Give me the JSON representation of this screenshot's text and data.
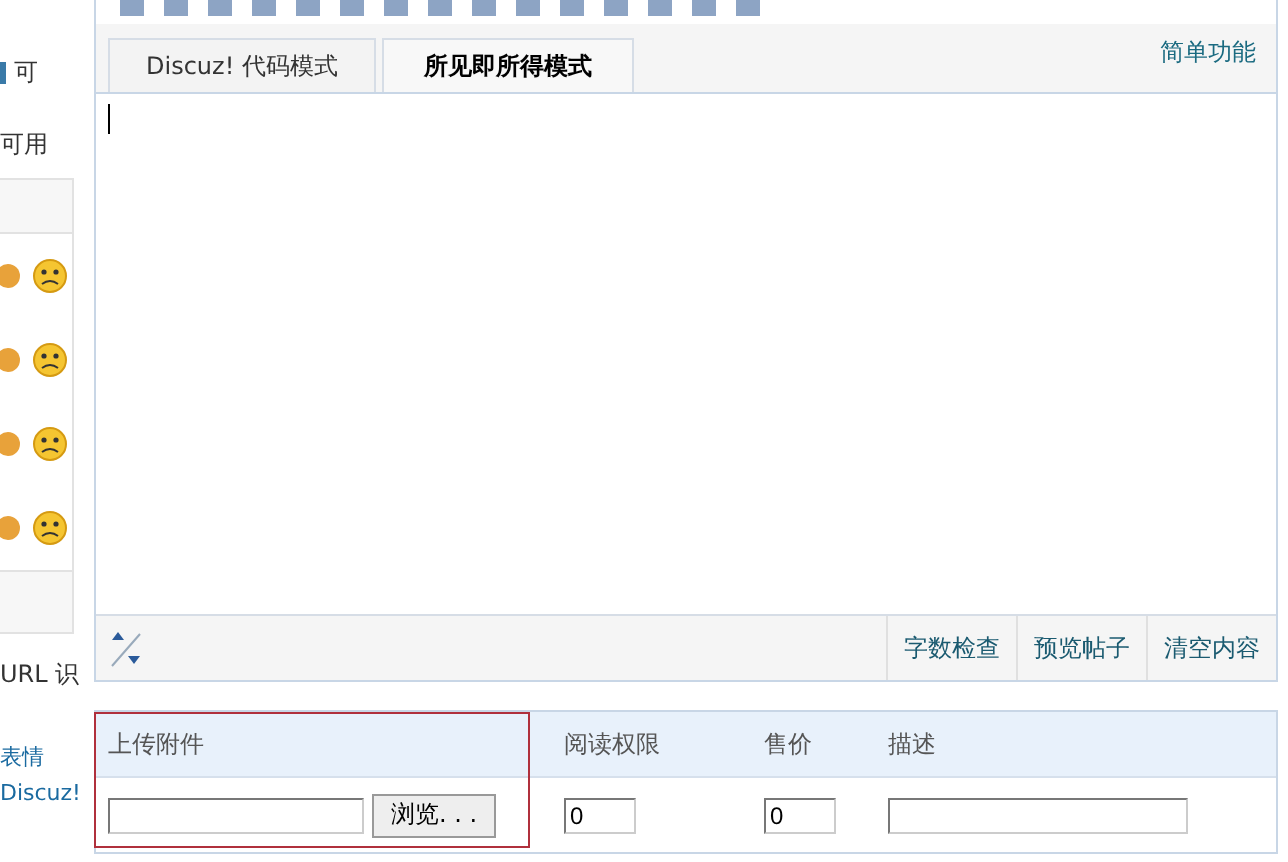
{
  "sidebar": {
    "texts": [
      "可",
      "可用"
    ],
    "footer_text": "URL 识",
    "links": [
      "表情",
      "Discuz!"
    ]
  },
  "editor": {
    "tabs": [
      {
        "label": "Discuz! 代码模式",
        "selected": false
      },
      {
        "label": "所见即所得模式",
        "selected": true
      }
    ],
    "mode_link": "简单功能",
    "actions": [
      "字数检查",
      "预览帖子",
      "清空内容"
    ]
  },
  "attachments": {
    "columns": [
      "上传附件",
      "阅读权限",
      "售价",
      "描述"
    ],
    "browse_button": "浏览. . .",
    "permission_value": "0",
    "price_value": "0"
  }
}
